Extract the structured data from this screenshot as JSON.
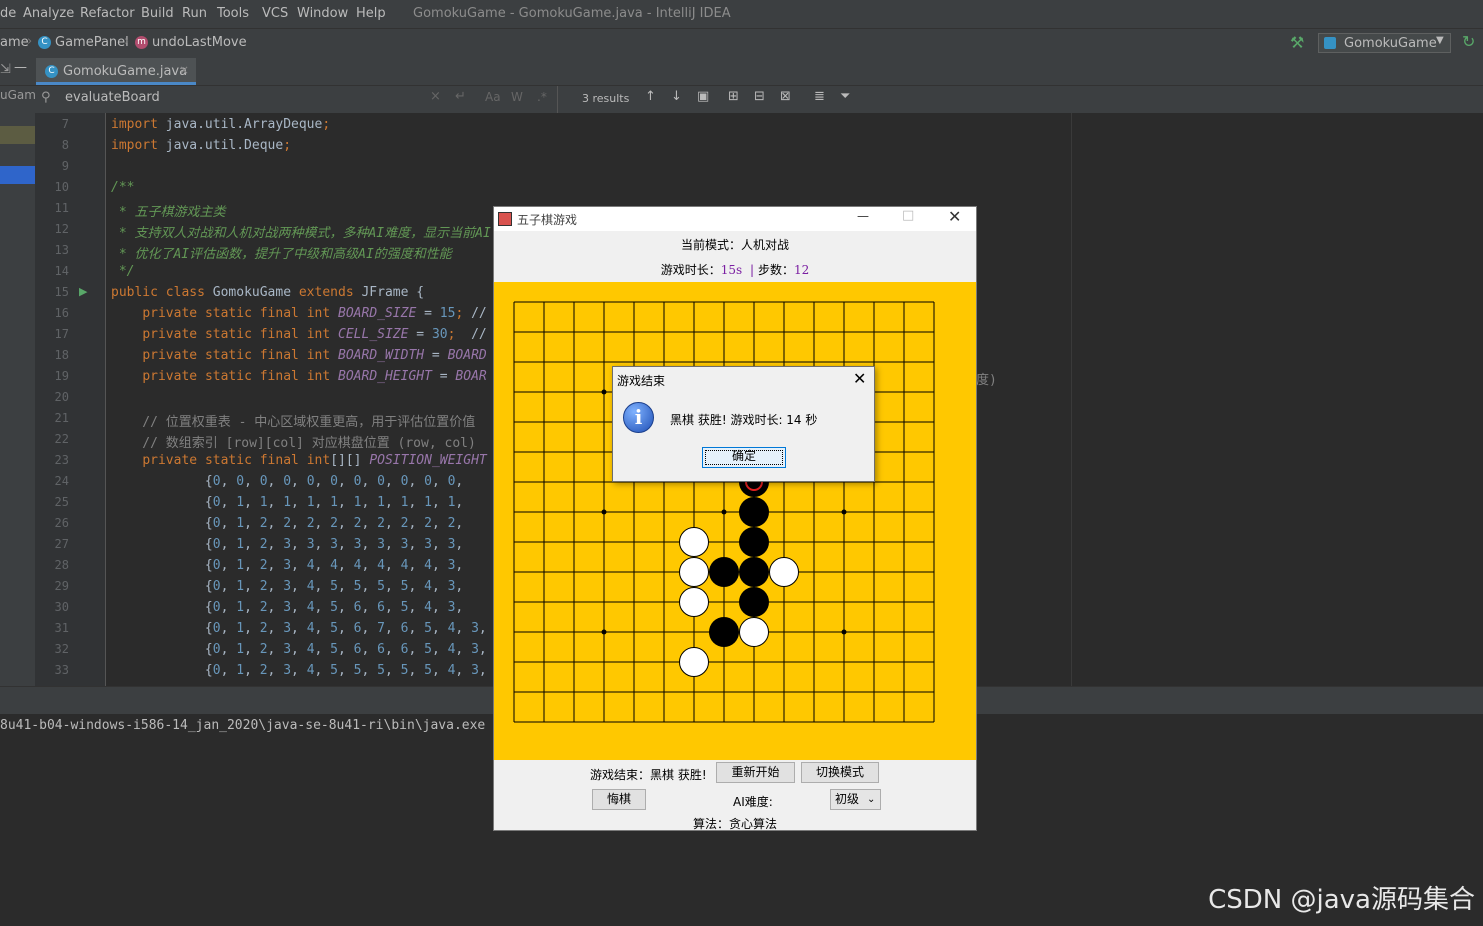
{
  "ide": {
    "menu": [
      "de",
      "Analyze",
      "Refactor",
      "Build",
      "Run",
      "Tools",
      "VCS",
      "Window",
      "Help"
    ],
    "window_title": "GomokuGame - GomokuGame.java - IntelliJ IDEA",
    "breadcrumb": [
      "ame",
      "GamePanel",
      "undoLastMove"
    ],
    "run_config": "GomokuGame",
    "left_label": "uGam",
    "tab": "GomokuGame.java",
    "search": {
      "query": "evaluateBoard",
      "results": "3 results",
      "opt_case": "Aa",
      "opt_word": "W",
      "opt_regex": ".*"
    },
    "code_lines": [
      {
        "n": "7",
        "t": "import java.util.ArrayDeque;"
      },
      {
        "n": "8",
        "t": "import java.util.Deque;"
      },
      {
        "n": "9",
        "t": ""
      },
      {
        "n": "10",
        "t": "/**"
      },
      {
        "n": "11",
        "t": " * 五子棋游戏主类"
      },
      {
        "n": "12",
        "t": " * 支持双人对战和人机对战两种模式，多种AI难度，显示当前AI"
      },
      {
        "n": "13",
        "t": " * 优化了AI评估函数，提升了中级和高级AI的强度和性能"
      },
      {
        "n": "14",
        "t": " */"
      },
      {
        "n": "15",
        "t": "public class GomokuGame extends JFrame {"
      },
      {
        "n": "16",
        "t": "    private static final int BOARD_SIZE = 15; //"
      },
      {
        "n": "17",
        "t": "    private static final int CELL_SIZE = 30;  //"
      },
      {
        "n": "18",
        "t": "    private static final int BOARD_WIDTH = BOARD"
      },
      {
        "n": "19",
        "t": "    private static final int BOARD_HEIGHT = BOAR"
      },
      {
        "n": "20",
        "t": ""
      },
      {
        "n": "21",
        "t": "    // 位置权重表 - 中心区域权重更高，用于评估位置价值"
      },
      {
        "n": "22",
        "t": "    // 数组索引 [row][col] 对应棋盘位置 (row, col) "
      },
      {
        "n": "23",
        "t": "    private static final int[][] POSITION_WEIGHT"
      },
      {
        "n": "24",
        "t": "            {0, 0, 0, 0, 0, 0, 0, 0, 0, 0, 0,"
      },
      {
        "n": "25",
        "t": "            {0, 1, 1, 1, 1, 1, 1, 1, 1, 1, 1,"
      },
      {
        "n": "26",
        "t": "            {0, 1, 2, 2, 2, 2, 2, 2, 2, 2, 2,"
      },
      {
        "n": "27",
        "t": "            {0, 1, 2, 3, 3, 3, 3, 3, 3, 3, 3,"
      },
      {
        "n": "28",
        "t": "            {0, 1, 2, 3, 4, 4, 4, 4, 4, 4, 3,"
      },
      {
        "n": "29",
        "t": "            {0, 1, 2, 3, 4, 5, 5, 5, 5, 4, 3,"
      },
      {
        "n": "30",
        "t": "            {0, 1, 2, 3, 4, 5, 6, 6, 5, 4, 3,"
      },
      {
        "n": "31",
        "t": "            {0, 1, 2, 3, 4, 5, 6, 7, 6, 5, 4, 3,"
      },
      {
        "n": "32",
        "t": "            {0, 1, 2, 3, 4, 5, 6, 6, 6, 5, 4, 3,"
      },
      {
        "n": "33",
        "t": "            {0, 1, 2, 3, 4, 5, 5, 5, 5, 5, 4, 3,"
      }
    ],
    "code_tail_19": "度)",
    "console_path": "8u41-b04-windows-i586-14_jan_2020\\java-se-8u41-ri\\bin\\java.exe",
    "watermark": "CSDN @java源码集合"
  },
  "game": {
    "title": "五子棋游戏",
    "mode": "当前模式：人机对战",
    "time_label": "游戏时长：",
    "time_value": "15s",
    "steps_label": "步数：",
    "steps_value": "12",
    "status": "游戏结束：黑棋 获胜!",
    "restart": "重新开始",
    "switch_mode": "切换模式",
    "undo": "悔棋",
    "ai_label": "AI难度:",
    "ai_level": "初级",
    "algo": "算法：贪心算法",
    "board_size": 15,
    "black_stones": [
      [
        6,
        8
      ],
      [
        7,
        8
      ],
      [
        8,
        8
      ],
      [
        9,
        7
      ],
      [
        9,
        8
      ],
      [
        10,
        8
      ],
      [
        11,
        7
      ]
    ],
    "white_stones": [
      [
        8,
        6
      ],
      [
        9,
        6
      ],
      [
        9,
        9
      ],
      [
        10,
        6
      ],
      [
        11,
        8
      ],
      [
        12,
        6
      ]
    ],
    "last_move": [
      6,
      8
    ],
    "star_points": [
      [
        3,
        3
      ],
      [
        3,
        11
      ],
      [
        7,
        3
      ],
      [
        7,
        7
      ],
      [
        7,
        11
      ],
      [
        11,
        3
      ],
      [
        11,
        11
      ]
    ],
    "colors": {
      "board": "#ffc800",
      "accent_purple": "#7b1fa2"
    }
  },
  "dialog": {
    "title": "游戏结束",
    "message": "黑棋 获胜! 游戏时长: 14 秒",
    "ok": "确定"
  }
}
